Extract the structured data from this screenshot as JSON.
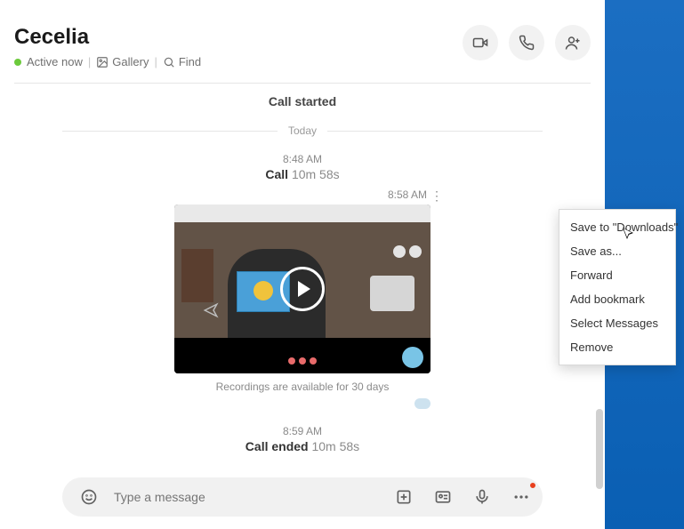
{
  "contact": {
    "name": "Cecelia",
    "status": "Active now"
  },
  "header_links": {
    "gallery": "Gallery",
    "find": "Find"
  },
  "events": {
    "call_started": "Call started",
    "today": "Today",
    "call1": {
      "time": "8:48 AM",
      "label": "Call",
      "duration": "10m 58s"
    },
    "recording": {
      "time": "8:58 AM",
      "caption": "Recordings are available for 30 days"
    },
    "call_ended": {
      "time": "8:59 AM",
      "label": "Call ended",
      "duration": "10m 58s"
    }
  },
  "context_menu": {
    "save_downloads": "Save to \"Downloads\"",
    "save_as": "Save as...",
    "forward": "Forward",
    "add_bookmark": "Add bookmark",
    "select_messages": "Select Messages",
    "remove": "Remove"
  },
  "composer": {
    "placeholder": "Type a message"
  }
}
